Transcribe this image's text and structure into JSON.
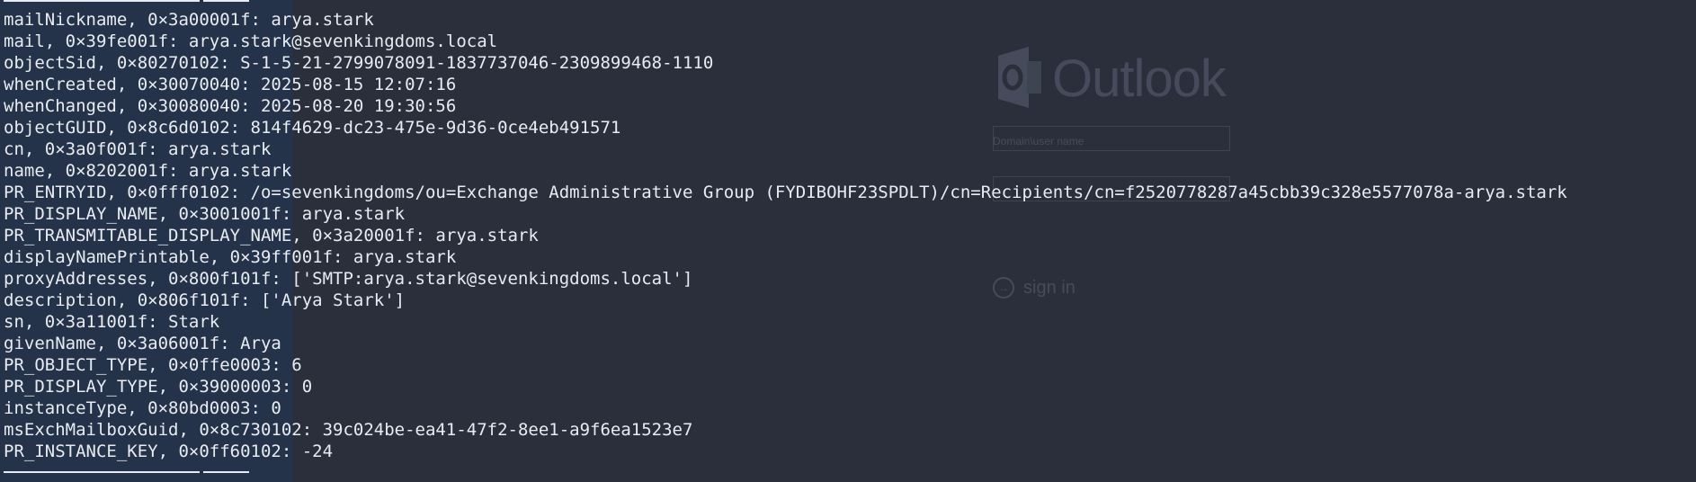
{
  "terminal": {
    "lines": [
      "mailNickname, 0×3a00001f: arya.stark",
      "mail, 0×39fe001f: arya.stark@sevenkingdoms.local",
      "objectSid, 0×80270102: S-1-5-21-2799078091-1837737046-2309899468-1110",
      "whenCreated, 0×30070040: 2025-08-15 12:07:16",
      "whenChanged, 0×30080040: 2025-08-20 19:30:56",
      "objectGUID, 0×8c6d0102: 814f4629-dc23-475e-9d36-0ce4eb491571",
      "cn, 0×3a0f001f: arya.stark",
      "name, 0×8202001f: arya.stark",
      "PR_ENTRYID, 0×0fff0102: /o=sevenkingdoms/ou=Exchange Administrative Group (FYDIBOHF23SPDLT)/cn=Recipients/cn=f2520778287a45cbb39c328e5577078a-arya.stark",
      "PR_DISPLAY_NAME, 0×3001001f: arya.stark",
      "PR_TRANSMITABLE_DISPLAY_NAME, 0×3a20001f: arya.stark",
      "displayNamePrintable, 0×39ff001f: arya.stark",
      "proxyAddresses, 0×800f101f: ['SMTP:arya.stark@sevenkingdoms.local']",
      "description, 0×806f101f: ['Arya Stark']",
      "sn, 0×3a11001f: Stark",
      "givenName, 0×3a06001f: Arya",
      "PR_OBJECT_TYPE, 0×0ffe0003: 6",
      "PR_DISPLAY_TYPE, 0×39000003: 0",
      "instanceType, 0×80bd0003: 0",
      "msExchMailboxGuid, 0×8c730102: 39c024be-ea41-47f2-8ee1-a9f6ea1523e7",
      "PR_INSTANCE_KEY, 0×0ff60102: -24"
    ]
  },
  "background": {
    "app_name": "Outlook",
    "field_label": "Domain\\user name",
    "sign_in_label": "sign in"
  }
}
